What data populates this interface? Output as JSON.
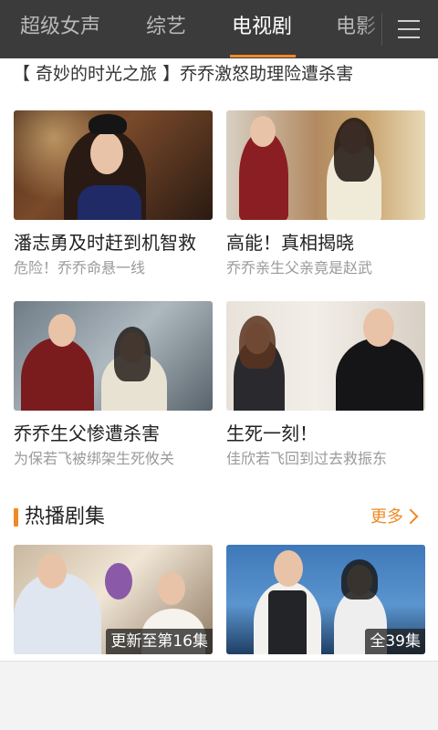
{
  "tabs": [
    {
      "label": "超级女声",
      "active": false
    },
    {
      "label": "综艺",
      "active": false
    },
    {
      "label": "电视剧",
      "active": true
    },
    {
      "label": "电影",
      "active": false
    }
  ],
  "headline": "【 奇妙的时光之旅 】乔乔激怒助理险遭杀害",
  "cards": [
    {
      "title": "潘志勇及时赶到机智救",
      "subtitle": "危险！乔乔命悬一线"
    },
    {
      "title": "高能！真相揭晓",
      "subtitle": "乔乔亲生父亲竟是赵武"
    },
    {
      "title": "乔乔生父惨遭杀害",
      "subtitle": "为保若飞被绑架生死攸关"
    },
    {
      "title": "生死一刻！",
      "subtitle": "佳欣若飞回到过去救振东"
    }
  ],
  "section": {
    "label": "热播剧集",
    "more": "更多"
  },
  "hot": [
    {
      "badge": "更新至第16集"
    },
    {
      "badge": "全39集"
    }
  ],
  "colors": {
    "accent": "#f08a24",
    "topbar": "#3b3b3b"
  }
}
